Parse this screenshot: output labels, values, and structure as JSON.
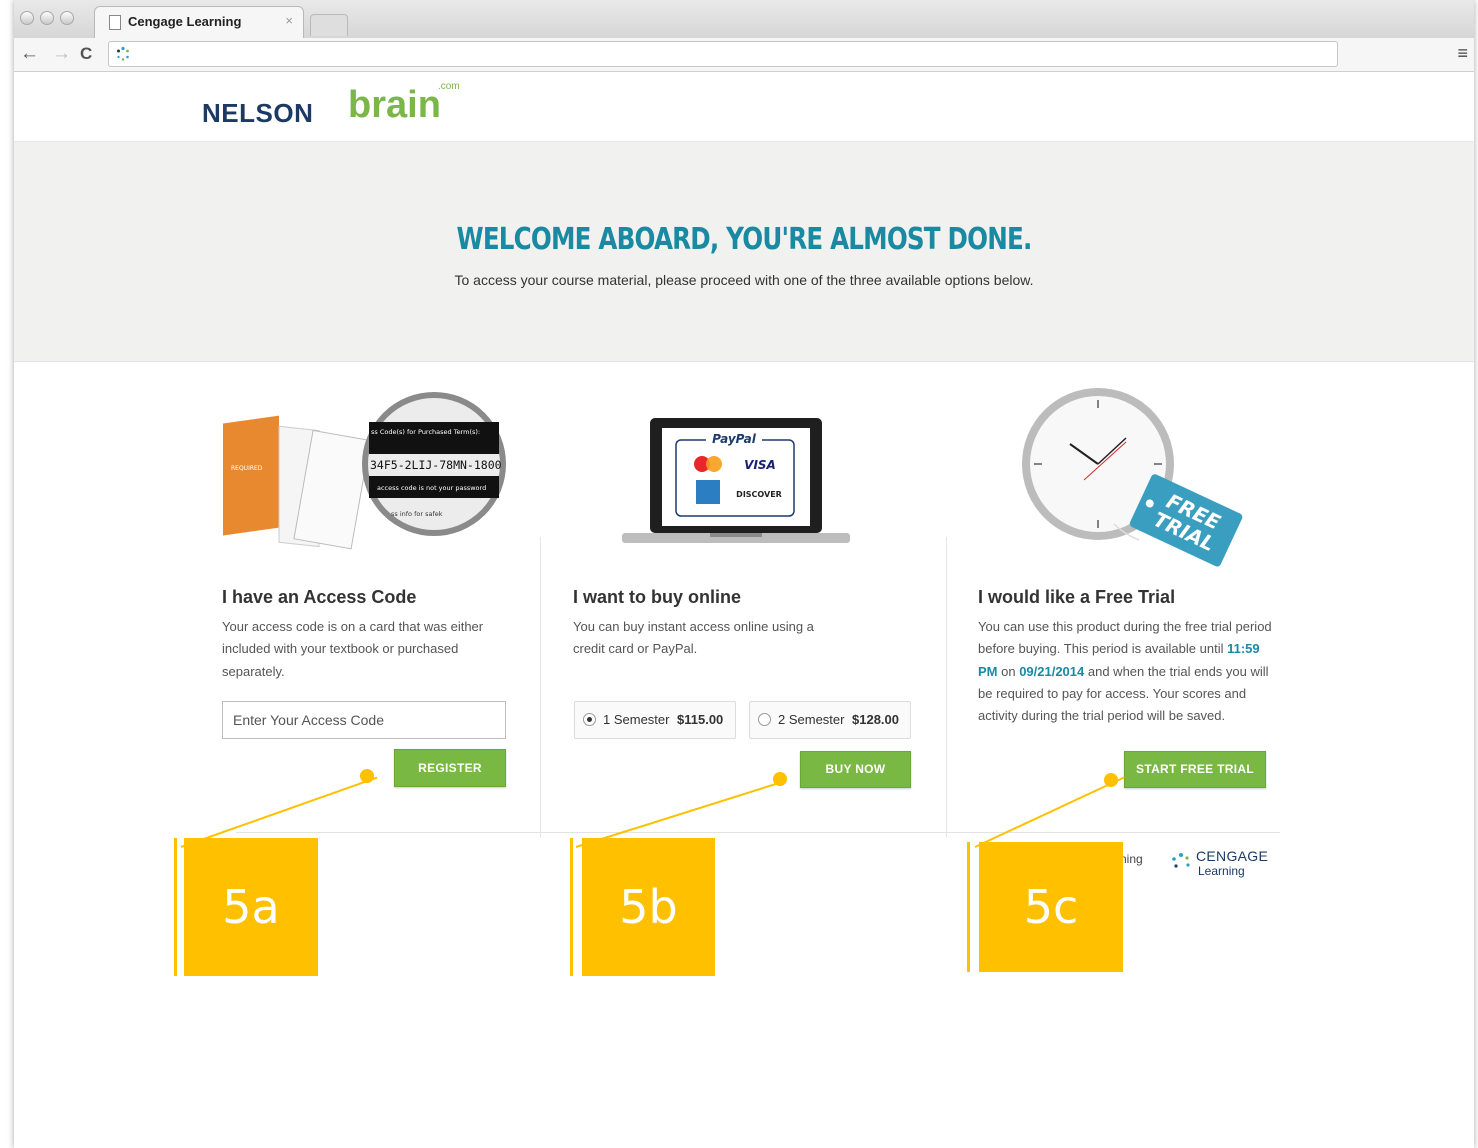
{
  "browser": {
    "tab_title": "Cengage Learning",
    "tab_close": "×",
    "back_icon": "←",
    "forward_icon": "→",
    "reload_icon": "C",
    "menu_icon": "≡"
  },
  "header": {
    "logo_nelson": "NELSON",
    "logo_brain": "brain",
    "logo_com": ".com"
  },
  "hero": {
    "title": "WELCOME ABOARD, YOU'RE ALMOST DONE.",
    "subtitle": "To access your course material, please proceed with one of the three available options below."
  },
  "access_code": {
    "card_tag": "REQUIRED",
    "magnifier_top": "ss Code(s) for Purchased Term(s):",
    "magnifier_code": "34F5-2LIJ-78MN-1800",
    "magnifier_note": "access code is not your password",
    "magnifier_bottom": "ss info for safek",
    "title": "I have an Access Code",
    "body": "Your access code is on a card that was either included with your textbook or purchased separately.",
    "input_placeholder": "Enter Your Access Code",
    "button": "REGISTER"
  },
  "buy_online": {
    "paypal": "PayPal",
    "visa": "VISA",
    "mastercard": "MasterCard",
    "discover": "DISCOVER",
    "title": "I want to buy online",
    "body": "You can buy instant access online using a credit card or PayPal.",
    "option1_label": "1 Semester",
    "option1_price": "$115.00",
    "option2_label": "2 Semester",
    "option2_price": "$128.00",
    "button": "BUY NOW"
  },
  "free_trial": {
    "tag": "FREE TRIAL",
    "tag_line1": "FREE",
    "tag_line2": "TRIAL",
    "title": "I would like a Free Trial",
    "body_1": "You can use this product during the free trial period before buying. This period is available until ",
    "time": "11:59 PM",
    "body_2": " on ",
    "date": "09/21/2014",
    "body_3": " and when the trial ends you will be required to pay for access. Your scores and activity during the trial period will be saved.",
    "button": "START FREE TRIAL"
  },
  "footer": {
    "partial_text": "rning",
    "cengage": "CENGAGE",
    "learning": "Learning"
  },
  "annotations": [
    "5a",
    "5b",
    "5c"
  ],
  "colors": {
    "accent_teal": "#1a8aa3",
    "button_green": "#79b943",
    "callout_yellow": "#ffc000",
    "logo_navy": "#1c3a63"
  }
}
